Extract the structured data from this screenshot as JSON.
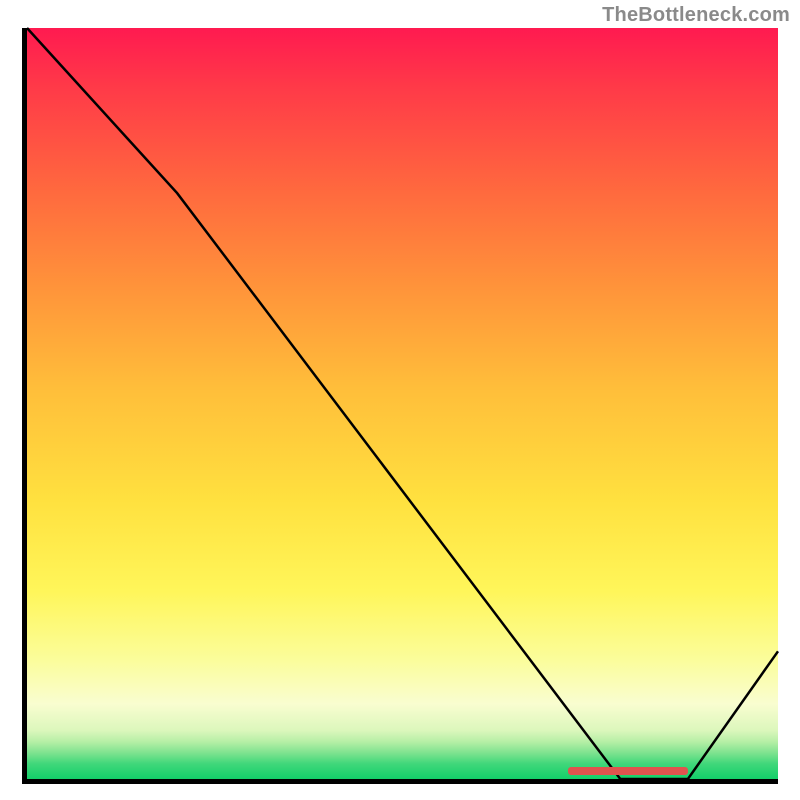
{
  "attribution": "TheBottleneck.com",
  "chart_data": {
    "type": "line",
    "title": "",
    "xlabel": "",
    "ylabel": "",
    "xlim": [
      0,
      100
    ],
    "ylim": [
      0,
      100
    ],
    "grid": false,
    "legend": false,
    "series": [
      {
        "name": "curve",
        "x": [
          0,
          20,
          79,
          88,
          100
        ],
        "values": [
          100,
          78,
          0,
          0,
          17
        ]
      }
    ],
    "optimal_band": {
      "x_start": 72,
      "x_end": 88,
      "y": 0
    },
    "background_gradient_stops": [
      {
        "pos": 0,
        "color": "#ff1a50"
      },
      {
        "pos": 35,
        "color": "#ff953a"
      },
      {
        "pos": 63,
        "color": "#ffe13f"
      },
      {
        "pos": 90,
        "color": "#f9fdd0"
      },
      {
        "pos": 100,
        "color": "#13cf69"
      }
    ]
  }
}
